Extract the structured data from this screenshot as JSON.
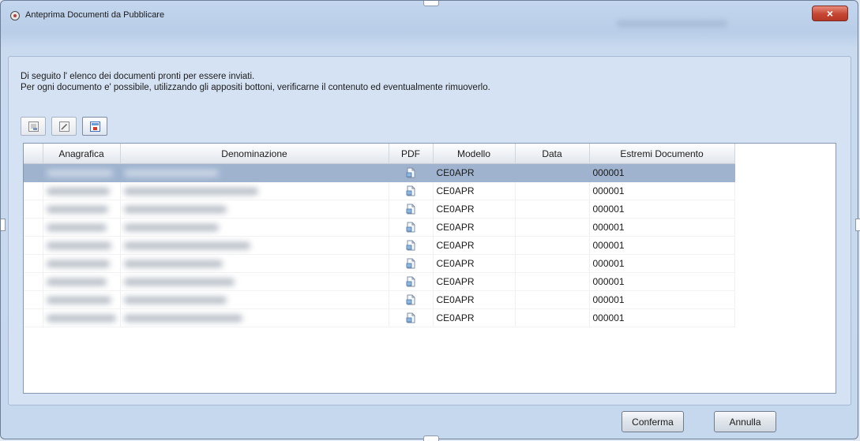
{
  "window": {
    "title": "Anteprima Documenti da Pubblicare",
    "close_label": "×"
  },
  "description": {
    "line1": "Di seguito l' elenco dei documenti pronti per essere inviati.",
    "line2": "Per ogni documento e' possibile, utilizzando gli appositi bottoni, verificarne il contenuto ed eventualmente rimuoverlo."
  },
  "toolbar": {
    "buttons": [
      {
        "icon": "preview-document-icon"
      },
      {
        "icon": "edit-document-icon"
      },
      {
        "icon": "remove-document-icon"
      }
    ]
  },
  "grid": {
    "columns": [
      "Anagrafica",
      "Denominazione",
      "PDF",
      "Modello",
      "Data",
      "Estremi Documento"
    ],
    "rows": [
      {
        "modello": "CE0APR",
        "data": "",
        "estremi": "000001",
        "selected": true
      },
      {
        "modello": "CE0APR",
        "data": "",
        "estremi": "000001",
        "selected": false
      },
      {
        "modello": "CE0APR",
        "data": "",
        "estremi": "000001",
        "selected": false
      },
      {
        "modello": "CE0APR",
        "data": "",
        "estremi": "000001",
        "selected": false
      },
      {
        "modello": "CE0APR",
        "data": "",
        "estremi": "000001",
        "selected": false
      },
      {
        "modello": "CE0APR",
        "data": "",
        "estremi": "000001",
        "selected": false
      },
      {
        "modello": "CE0APR",
        "data": "",
        "estremi": "000001",
        "selected": false
      },
      {
        "modello": "CE0APR",
        "data": "",
        "estremi": "000001",
        "selected": false
      },
      {
        "modello": "CE0APR",
        "data": "",
        "estremi": "000001",
        "selected": false
      }
    ]
  },
  "buttons": {
    "confirm": "Conferma",
    "cancel": "Annulla"
  },
  "colors": {
    "selection": "#9fb3cf",
    "window_bg": "#c6d8ee",
    "close_button": "#c44633"
  }
}
